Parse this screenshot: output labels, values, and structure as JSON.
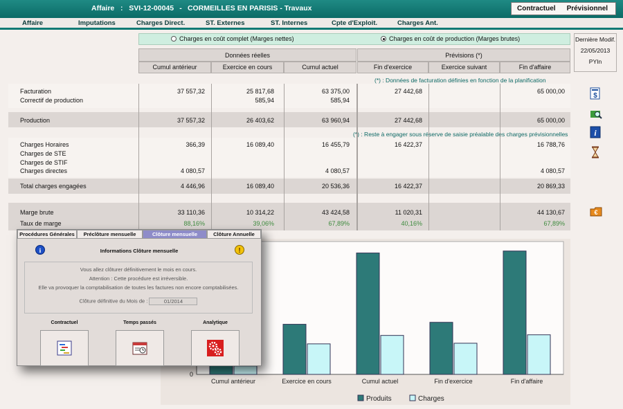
{
  "header": {
    "affaire_label": "Affaire",
    "affaire_sep": ":",
    "affaire_code": "SVI-12-00045",
    "dash": "-",
    "affaire_name": "CORMEILLES EN PARISIS - Travaux",
    "btn_contractuel": "Contractuel",
    "btn_previsionnel": "Prévisionnel"
  },
  "menu": [
    "Affaire",
    "Imputations",
    "Charges Direct.",
    "ST. Externes",
    "ST. Internes",
    "Cpte d'Exploit.",
    "Charges Ant."
  ],
  "mode": {
    "option1": "Charges en coût complet (Marges nettes)",
    "option2": "Charges en coût de production (Marges brutes)",
    "selected": 2
  },
  "columns": {
    "group_reel": "Données réelles",
    "group_prev": "Prévisions (*)",
    "c1": "Cumul antérieur",
    "c2": "Exercice en cours",
    "c3": "Cumul actuel",
    "c4": "Fin d'exercice",
    "c5": "Exercice suivant",
    "c6": "Fin d'affaire"
  },
  "modif": {
    "label": "Dernière Modif.",
    "date": "22/05/2013",
    "user": "PYIn"
  },
  "notes": {
    "n1": "(*) : Données de facturation définies en fonction de la planification",
    "n2": "(*) : Reste à engager sous réserve de saisie préalable des charges prévisionnelles"
  },
  "rows": {
    "facturation": {
      "label": "Facturation",
      "c1": "37 557,32",
      "c2": "25 817,68",
      "c3": "63 375,00",
      "c4": "27 442,68",
      "c5": "",
      "c6": "65 000,00"
    },
    "correctif": {
      "label": "Correctif de production",
      "c1": "",
      "c2": "585,94",
      "c3": "585,94",
      "c4": "",
      "c5": "",
      "c6": ""
    },
    "production": {
      "label": "Production",
      "c1": "37 557,32",
      "c2": "26 403,62",
      "c3": "63 960,94",
      "c4": "27 442,68",
      "c5": "",
      "c6": "65 000,00"
    },
    "horaires": {
      "label": "Charges Horaires",
      "c1": "366,39",
      "c2": "16 089,40",
      "c3": "16 455,79",
      "c4": "16 422,37",
      "c5": "",
      "c6": "16 788,76"
    },
    "ste": {
      "label": "Charges de STE"
    },
    "stif": {
      "label": "Charges de STIF"
    },
    "directes": {
      "label": "Charges directes",
      "c1": "4 080,57",
      "c2": "",
      "c3": "4 080,57",
      "c4": "",
      "c5": "",
      "c6": "4 080,57"
    },
    "total": {
      "label": "Total charges engagées",
      "c1": "4 446,96",
      "c2": "16 089,40",
      "c3": "20 536,36",
      "c4": "16 422,37",
      "c5": "",
      "c6": "20 869,33"
    },
    "marge": {
      "label": "Marge brute",
      "c1": "33 110,36",
      "c2": "10 314,22",
      "c3": "43 424,58",
      "c4": "11 020,31",
      "c5": "",
      "c6": "44 130,67"
    },
    "taux": {
      "label": "Taux de marge",
      "c1": "88,16%",
      "c2": "39,06%",
      "c3": "67,89%",
      "c4": "40,16%",
      "c5": "",
      "c6": "67,89%"
    }
  },
  "dialog": {
    "tabs": [
      "Procédures Générales",
      "Préclôture mensuelle",
      "Clôture mensuelle",
      "Clôture Annuelle"
    ],
    "active_tab": 2,
    "title": "Informations Clôture mensuelle",
    "line1": "Vous allez clôturer définitivement le mois en cours.",
    "line2": "Attention : Cette procédure est irréversible.",
    "line3": "Elle va provoquer la comptabilisation de toutes les factures non encore comptabilisées.",
    "cloture_label": "Clôture définitive du Mois de :",
    "cloture_value": "01/2014",
    "btn1": "Contractuel",
    "btn2": "Temps passés",
    "btn3": "Analytique"
  },
  "colors": {
    "produits": "#2d7a78",
    "charges": "#c8f6f8",
    "accent": "#0b6b66"
  },
  "chart_data": {
    "type": "bar",
    "categories": [
      "Cumul antérieur",
      "Exercice en cours",
      "Cumul actuel",
      "Fin d'exercice",
      "Fin d'affaire"
    ],
    "series": [
      {
        "name": "Produits",
        "values": [
          37557.32,
          26403.62,
          63960.94,
          27442.68,
          65000.0
        ]
      },
      {
        "name": "Charges",
        "values": [
          4446.96,
          16089.4,
          20536.36,
          16422.37,
          20869.33
        ]
      }
    ],
    "ylim": [
      0,
      70000
    ],
    "ytick_visible": "0",
    "legend": "bottom"
  }
}
